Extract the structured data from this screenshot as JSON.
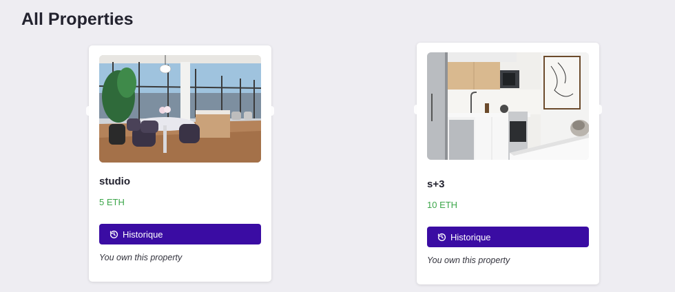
{
  "header": {
    "title": "All Properties"
  },
  "properties": [
    {
      "name": "studio",
      "price": "5 ETH",
      "history_label": "Historique",
      "ownership_note": "You own this property",
      "image": "apartment-dining-room-photo"
    },
    {
      "name": "s+3",
      "price": "10 ETH",
      "history_label": "Historique",
      "ownership_note": "You own this property",
      "image": "apartment-kitchen-photo"
    }
  ],
  "icons": {
    "history": "history-icon"
  },
  "colors": {
    "background": "#eeedf2",
    "button": "#3a0ca3",
    "price": "#3ca64a",
    "title": "#23232f"
  }
}
